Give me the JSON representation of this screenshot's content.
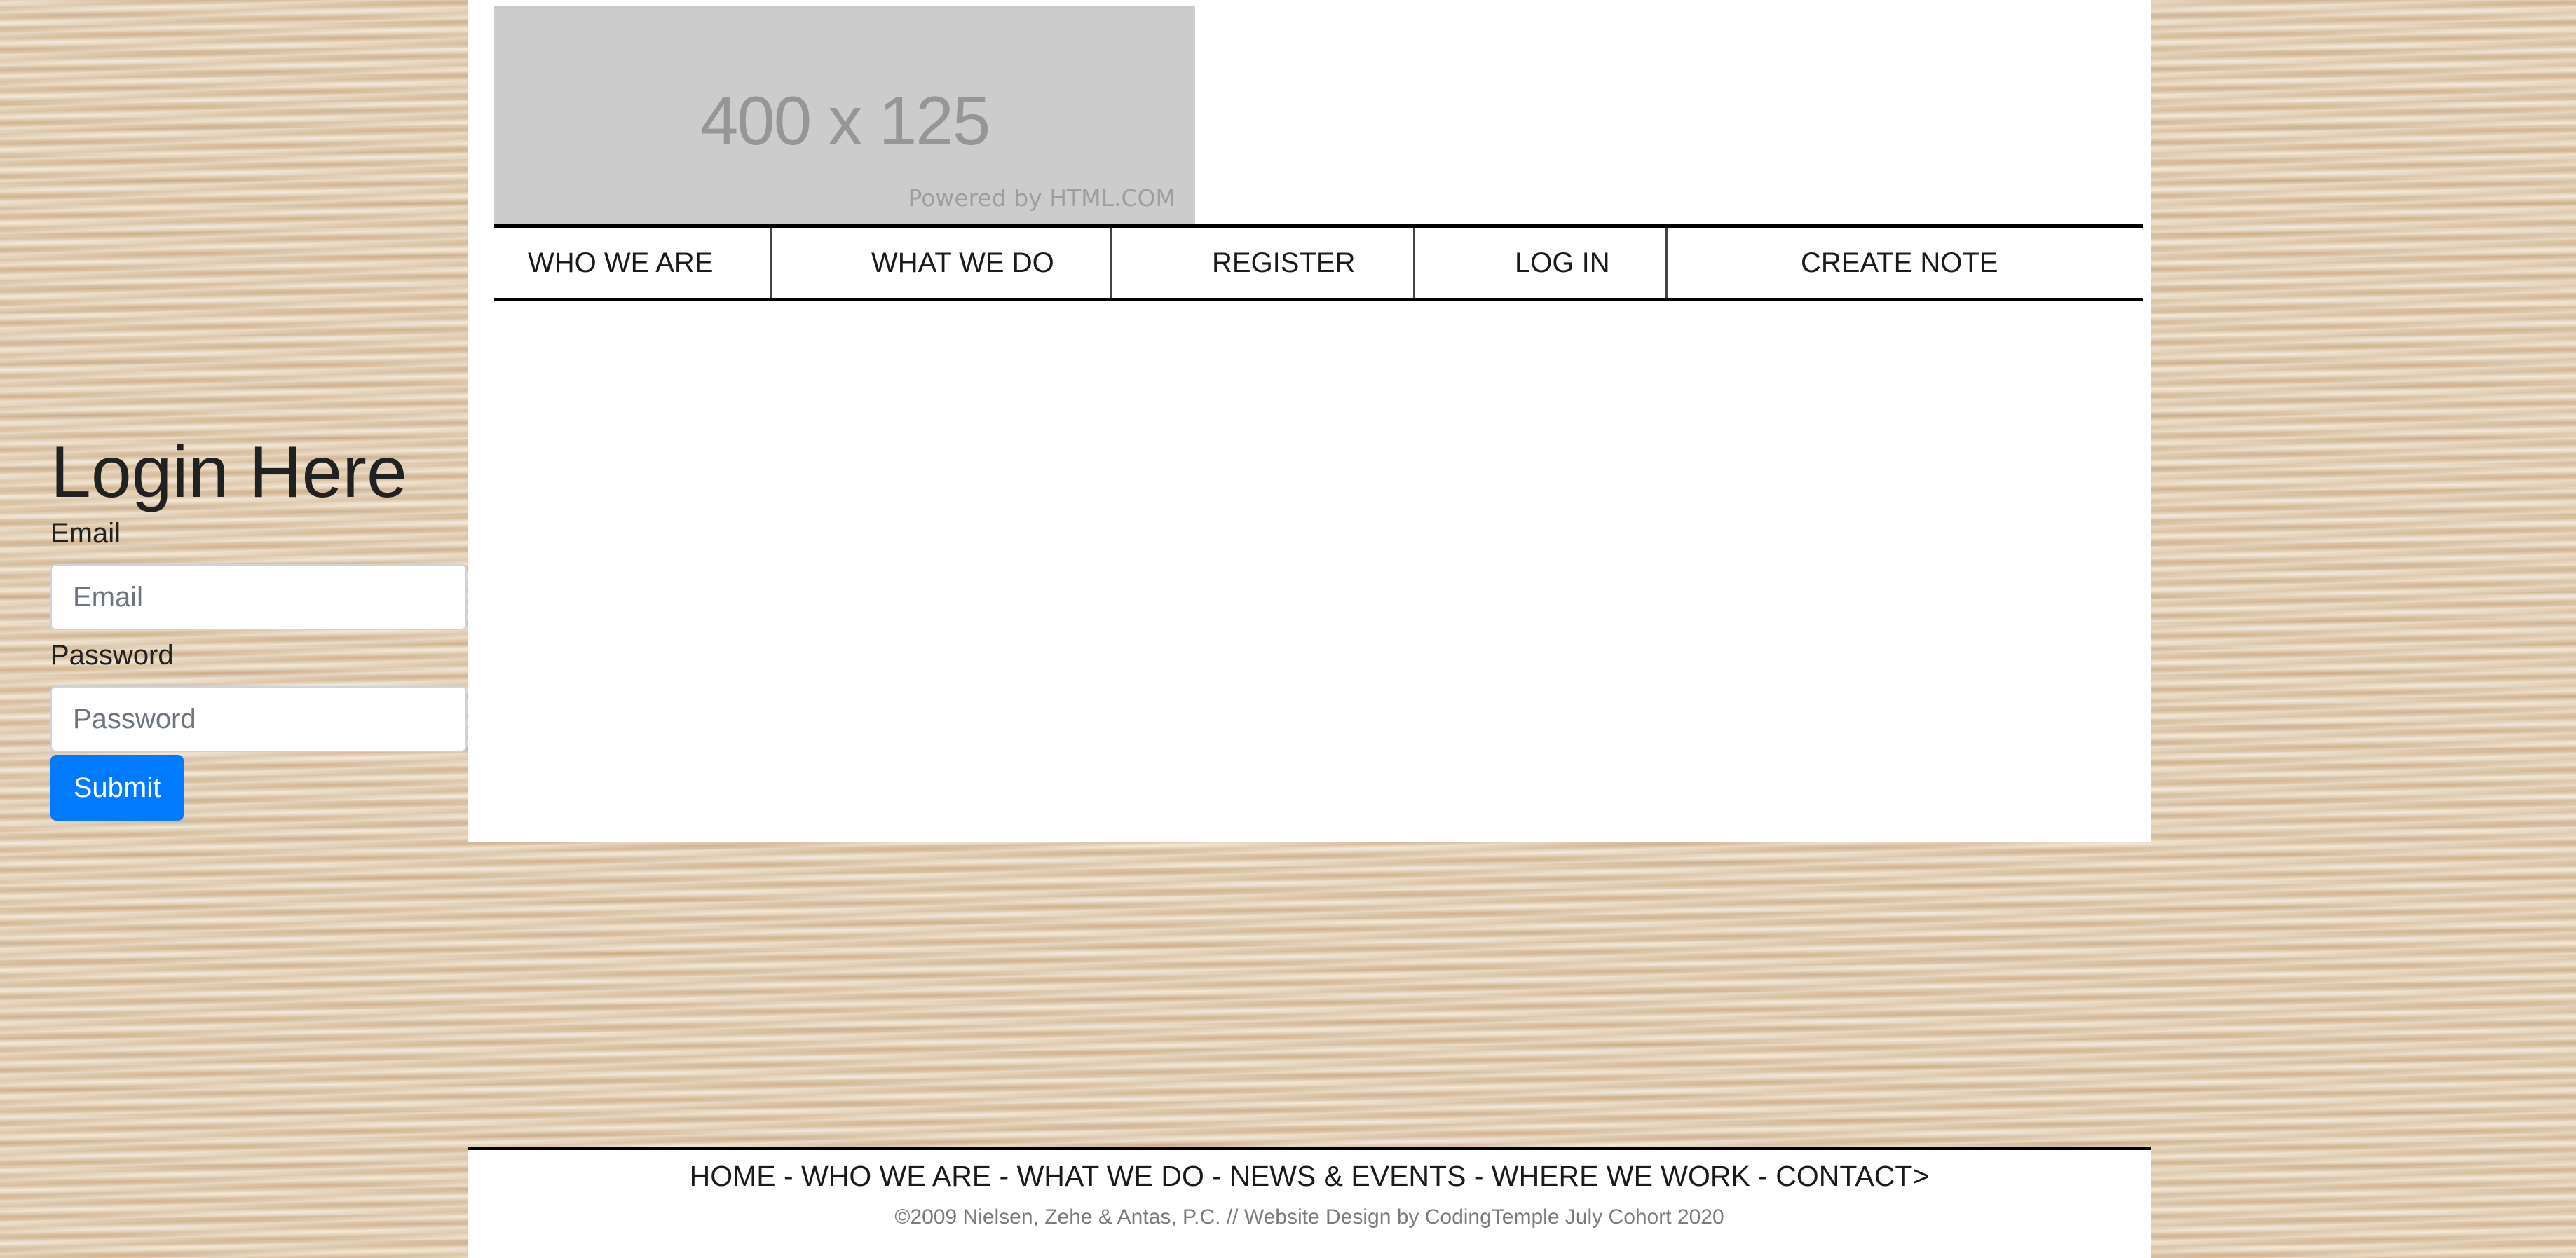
{
  "header": {
    "logo": {
      "size_text": "400 x 125",
      "powered_text": "Powered by HTML.COM"
    }
  },
  "nav": {
    "items": [
      {
        "label": "WHO WE ARE"
      },
      {
        "label": "WHAT WE DO"
      },
      {
        "label": "REGISTER"
      },
      {
        "label": "LOG IN"
      },
      {
        "label": "CREATE NOTE"
      }
    ]
  },
  "login": {
    "title": "Login Here",
    "email_label": "Email",
    "email_placeholder": "Email",
    "email_value": "",
    "password_label": "Password",
    "password_placeholder": "Password",
    "password_value": "",
    "submit_label": "Submit"
  },
  "footer": {
    "links": "HOME - WHO WE ARE - WHAT WE DO - NEWS & EVENTS - WHERE WE WORK - CONTACT>",
    "credit": "©2009 Nielsen, Zehe & Antas, P.C. // Website Design by CodingTemple July Cohort 2020"
  },
  "colors": {
    "primary_button": "#007bff",
    "border": "#000000",
    "placeholder_bg": "#cccccc"
  }
}
